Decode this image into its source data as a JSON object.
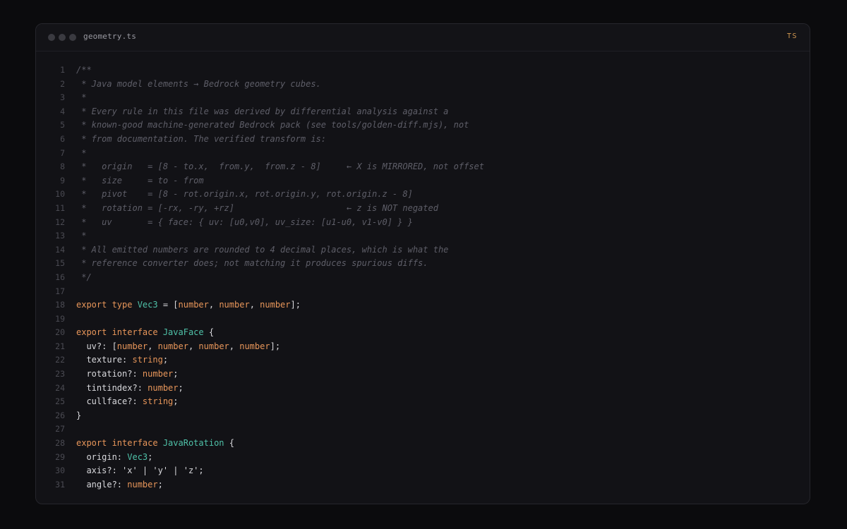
{
  "window": {
    "filename": "geometry.ts",
    "language_badge": "TS"
  },
  "code": {
    "lines": [
      {
        "n": "1",
        "tokens": [
          {
            "k": "cm",
            "t": "/**"
          }
        ]
      },
      {
        "n": "2",
        "tokens": [
          {
            "k": "cm",
            "t": " * Java model elements → Bedrock geometry cubes."
          }
        ]
      },
      {
        "n": "3",
        "tokens": [
          {
            "k": "cm",
            "t": " *"
          }
        ]
      },
      {
        "n": "4",
        "tokens": [
          {
            "k": "cm",
            "t": " * Every rule in this file was derived by differential analysis against a"
          }
        ]
      },
      {
        "n": "5",
        "tokens": [
          {
            "k": "cm",
            "t": " * known-good machine-generated Bedrock pack (see tools/golden-diff.mjs), not"
          }
        ]
      },
      {
        "n": "6",
        "tokens": [
          {
            "k": "cm",
            "t": " * from documentation. The verified transform is:"
          }
        ]
      },
      {
        "n": "7",
        "tokens": [
          {
            "k": "cm",
            "t": " *"
          }
        ]
      },
      {
        "n": "8",
        "tokens": [
          {
            "k": "cm",
            "t": " *   origin   = [8 - to.x,  from.y,  from.z - 8]     ← X is MIRRORED, not offset"
          }
        ]
      },
      {
        "n": "9",
        "tokens": [
          {
            "k": "cm",
            "t": " *   size     = to - from"
          }
        ]
      },
      {
        "n": "10",
        "tokens": [
          {
            "k": "cm",
            "t": " *   pivot    = [8 - rot.origin.x, rot.origin.y, rot.origin.z - 8]"
          }
        ]
      },
      {
        "n": "11",
        "tokens": [
          {
            "k": "cm",
            "t": " *   rotation = [-rx, -ry, +rz]                      ← z is NOT negated"
          }
        ]
      },
      {
        "n": "12",
        "tokens": [
          {
            "k": "cm",
            "t": " *   uv       = { face: { uv: [u0,v0], uv_size: [u1-u0, v1-v0] } }"
          }
        ]
      },
      {
        "n": "13",
        "tokens": [
          {
            "k": "cm",
            "t": " *"
          }
        ]
      },
      {
        "n": "14",
        "tokens": [
          {
            "k": "cm",
            "t": " * All emitted numbers are rounded to 4 decimal places, which is what the"
          }
        ]
      },
      {
        "n": "15",
        "tokens": [
          {
            "k": "cm",
            "t": " * reference converter does; not matching it produces spurious diffs."
          }
        ]
      },
      {
        "n": "16",
        "tokens": [
          {
            "k": "cm",
            "t": " */"
          }
        ]
      },
      {
        "n": "17",
        "tokens": []
      },
      {
        "n": "18",
        "tokens": [
          {
            "k": "kw",
            "t": "export type "
          },
          {
            "k": "ty",
            "t": "Vec3"
          },
          {
            "k": "pl",
            "t": " = ["
          },
          {
            "k": "nt",
            "t": "number"
          },
          {
            "k": "pl",
            "t": ", "
          },
          {
            "k": "nt",
            "t": "number"
          },
          {
            "k": "pl",
            "t": ", "
          },
          {
            "k": "nt",
            "t": "number"
          },
          {
            "k": "pl",
            "t": "];"
          }
        ]
      },
      {
        "n": "19",
        "tokens": []
      },
      {
        "n": "20",
        "tokens": [
          {
            "k": "kw",
            "t": "export interface "
          },
          {
            "k": "ty",
            "t": "JavaFace"
          },
          {
            "k": "pl",
            "t": " {"
          }
        ]
      },
      {
        "n": "21",
        "tokens": [
          {
            "k": "pl",
            "t": "  uv?: ["
          },
          {
            "k": "nt",
            "t": "number"
          },
          {
            "k": "pl",
            "t": ", "
          },
          {
            "k": "nt",
            "t": "number"
          },
          {
            "k": "pl",
            "t": ", "
          },
          {
            "k": "nt",
            "t": "number"
          },
          {
            "k": "pl",
            "t": ", "
          },
          {
            "k": "nt",
            "t": "number"
          },
          {
            "k": "pl",
            "t": "];"
          }
        ]
      },
      {
        "n": "22",
        "tokens": [
          {
            "k": "pl",
            "t": "  texture: "
          },
          {
            "k": "nt",
            "t": "string"
          },
          {
            "k": "pl",
            "t": ";"
          }
        ]
      },
      {
        "n": "23",
        "tokens": [
          {
            "k": "pl",
            "t": "  rotation?: "
          },
          {
            "k": "nt",
            "t": "number"
          },
          {
            "k": "pl",
            "t": ";"
          }
        ]
      },
      {
        "n": "24",
        "tokens": [
          {
            "k": "pl",
            "t": "  tintindex?: "
          },
          {
            "k": "nt",
            "t": "number"
          },
          {
            "k": "pl",
            "t": ";"
          }
        ]
      },
      {
        "n": "25",
        "tokens": [
          {
            "k": "pl",
            "t": "  cullface?: "
          },
          {
            "k": "nt",
            "t": "string"
          },
          {
            "k": "pl",
            "t": ";"
          }
        ]
      },
      {
        "n": "26",
        "tokens": [
          {
            "k": "pl",
            "t": "}"
          }
        ]
      },
      {
        "n": "27",
        "tokens": []
      },
      {
        "n": "28",
        "tokens": [
          {
            "k": "kw",
            "t": "export interface "
          },
          {
            "k": "ty",
            "t": "JavaRotation"
          },
          {
            "k": "pl",
            "t": " {"
          }
        ]
      },
      {
        "n": "29",
        "tokens": [
          {
            "k": "pl",
            "t": "  origin: "
          },
          {
            "k": "ty",
            "t": "Vec3"
          },
          {
            "k": "pl",
            "t": ";"
          }
        ]
      },
      {
        "n": "30",
        "tokens": [
          {
            "k": "pl",
            "t": "  axis?: 'x' | 'y' | 'z';"
          }
        ]
      },
      {
        "n": "31",
        "tokens": [
          {
            "k": "pl",
            "t": "  angle?: "
          },
          {
            "k": "nt",
            "t": "number"
          },
          {
            "k": "pl",
            "t": ";"
          }
        ]
      }
    ]
  }
}
